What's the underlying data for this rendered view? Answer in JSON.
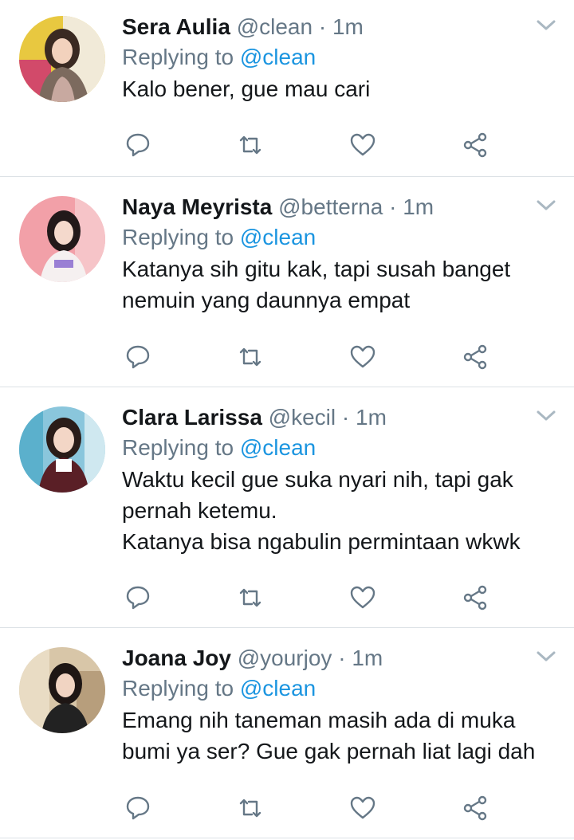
{
  "colors": {
    "name": "#14171a",
    "meta": "#657786",
    "mention": "#1b95e0",
    "divider": "#dde2e6"
  },
  "icons": [
    "reply-icon",
    "retweet-icon",
    "like-icon",
    "share-icon",
    "chevron-down-icon"
  ],
  "replies": [
    {
      "name": "Sera Aulia",
      "handle": "@clean",
      "time": "1m",
      "replying_label": "Replying to",
      "replying_to": "@clean",
      "lines": [
        "Kalo bener, gue mau cari"
      ]
    },
    {
      "name": "Naya Meyrista",
      "handle": "@betterna",
      "time": "1m",
      "replying_label": "Replying to",
      "replying_to": "@clean",
      "lines": [
        "Katanya sih gitu kak, tapi susah banget",
        "nemuin yang daunnya empat"
      ]
    },
    {
      "name": "Clara Larissa",
      "handle": "@kecil",
      "time": "1m",
      "replying_label": "Replying to",
      "replying_to": "@clean",
      "lines": [
        "Waktu kecil gue suka nyari nih, tapi gak",
        "pernah ketemu.",
        "Katanya bisa ngabulin permintaan wkwk"
      ]
    },
    {
      "name": "Joana Joy",
      "handle": "@yourjoy",
      "time": "1m",
      "replying_label": "Replying to",
      "replying_to": "@clean",
      "lines": [
        "Emang nih taneman masih ada di muka",
        "bumi ya ser? Gue gak pernah liat lagi dah"
      ]
    }
  ]
}
